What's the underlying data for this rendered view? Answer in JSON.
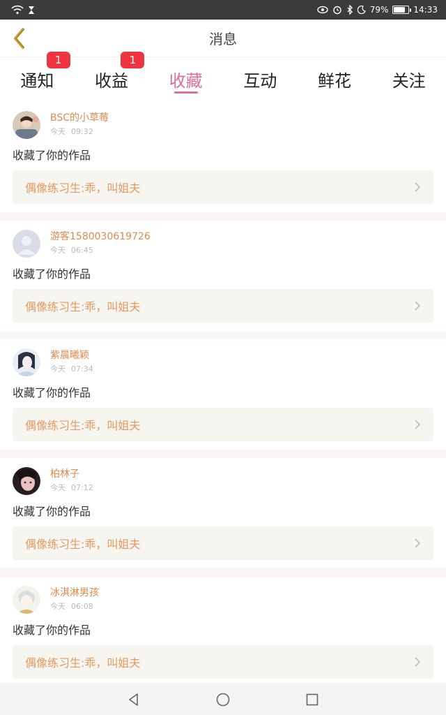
{
  "statusbar": {
    "battery_percent": "79%",
    "battery_level": 0.79,
    "time": "14:33"
  },
  "header": {
    "title": "消息"
  },
  "tabs": [
    {
      "label": "通知",
      "badge": "1",
      "active": false
    },
    {
      "label": "收益",
      "badge": "1",
      "active": false
    },
    {
      "label": "收藏",
      "badge": "",
      "active": true
    },
    {
      "label": "互动",
      "badge": "",
      "active": false
    },
    {
      "label": "鲜花",
      "badge": "",
      "active": false
    },
    {
      "label": "关注",
      "badge": "",
      "active": false
    }
  ],
  "colors": {
    "accent": "#e06d9a",
    "badge": "#ef3340",
    "username": "#e08a4e",
    "work_title": "#e39a62"
  },
  "messages": [
    {
      "user": "BSC的小草莓",
      "day": "今天",
      "time": "09:32",
      "action": "收藏了你的作品",
      "work": "偶像练习生:乖，叫姐夫"
    },
    {
      "user": "游客1580030619726",
      "day": "今天",
      "time": "06:45",
      "action": "收藏了你的作品",
      "work": "偶像练习生:乖，叫姐夫"
    },
    {
      "user": "紫晨曦颖",
      "day": "今天",
      "time": "07:34",
      "action": "收藏了你的作品",
      "work": "偶像练习生:乖，叫姐夫"
    },
    {
      "user": "柏林子",
      "day": "今天",
      "time": "07:12",
      "action": "收藏了你的作品",
      "work": "偶像练习生:乖，叫姐夫"
    },
    {
      "user": "冰淇淋男孩",
      "day": "今天",
      "time": "06:08",
      "action": "收藏了你的作品",
      "work": "偶像练习生:乖，叫姐夫"
    }
  ]
}
